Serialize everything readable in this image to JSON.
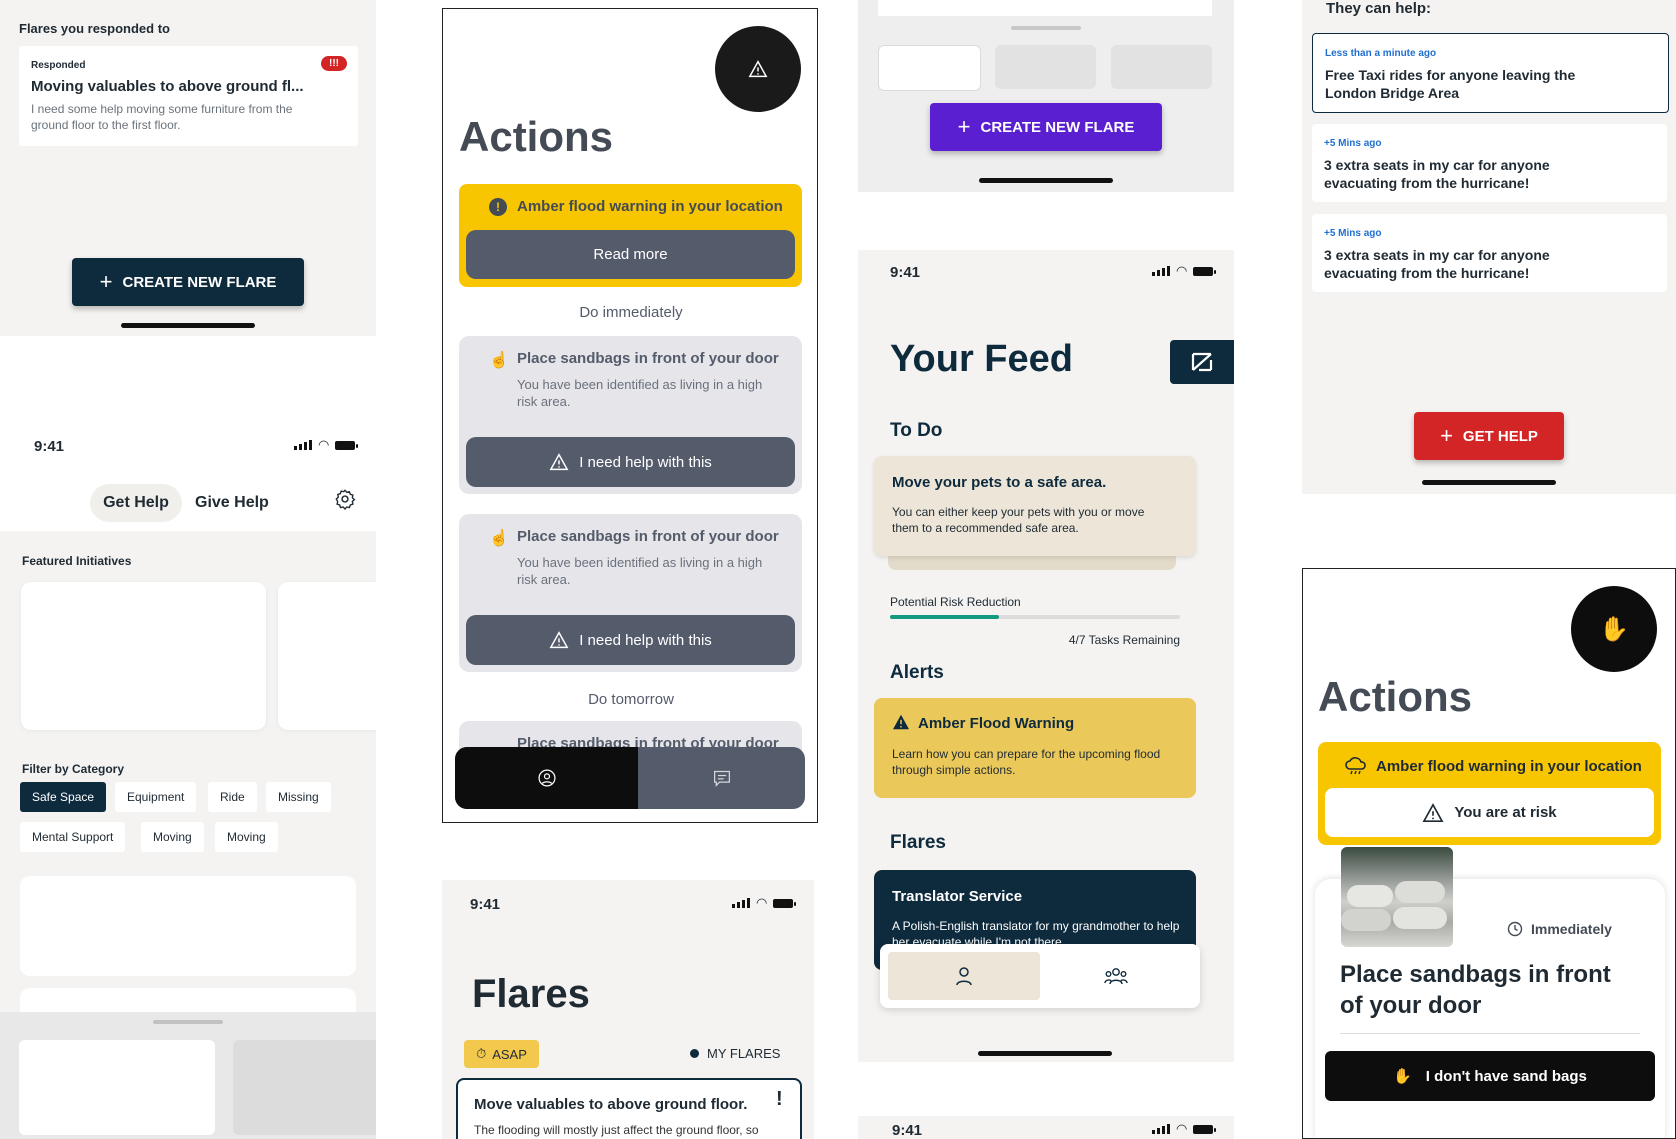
{
  "col1_top": {
    "section_title": "Flares you responded to",
    "card": {
      "badge": "Responded",
      "urgency": "!!!",
      "title": "Moving valuables to above ground fl...",
      "body": "I need some help moving some furniture from the ground floor to the first floor."
    },
    "create_label": "CREATE NEW FLARE"
  },
  "col1_main": {
    "status_time": "9:41",
    "tabs": [
      "Get Help",
      "Give Help"
    ],
    "featured_title": "Featured Initiatives",
    "filter_title": "Filter by Category",
    "chips": [
      "Safe Space",
      "Equipment",
      "Ride",
      "Missing",
      "Mental Support",
      "Moving",
      "Moving"
    ]
  },
  "col2_actions": {
    "title": "Actions",
    "alert_text": "Amber flood warning in your location",
    "read_more": "Read more",
    "group1": "Do immediately",
    "tasks": [
      {
        "title": "Place sandbags in front of your door",
        "desc": "You have been identified as living in a high risk area.",
        "help": "I need help with this"
      },
      {
        "title": "Place sandbags in front of your door",
        "desc": "You have been identified as living in a high risk area.",
        "help": "I need help with this"
      }
    ],
    "group2": "Do tomorrow",
    "peek_task": "Place sandbags in front of your door"
  },
  "col2_flares": {
    "status_time": "9:41",
    "title": "Flares",
    "asap": "ASAP",
    "my_flares": "MY FLARES",
    "card_title": "Move valuables to above ground floor.",
    "card_body": "The flooding will mostly just affect the ground floor, so any valuables should be moved higher up."
  },
  "col3_top": {
    "create_label": "CREATE NEW FLARE"
  },
  "col3_feed": {
    "status_time": "9:41",
    "title": "Your Feed",
    "todo_title": "To Do",
    "todo_card": {
      "title": "Move your pets to a safe area.",
      "body": "You can either keep your pets with you or move them to a recommended safe area."
    },
    "risk_label": "Potential Risk Reduction",
    "risk_progress": 0.375,
    "tasks_remaining": "4/7 Tasks Remaining",
    "alerts_title": "Alerts",
    "alert": {
      "title": "Amber Flood Warning",
      "body": "Learn how you can prepare for the upcoming flood through simple actions."
    },
    "flares_title": "Flares",
    "flare": {
      "title": "Translator Service",
      "body": "A Polish-English translator for my grandmother to help her evacuate while I'm not there."
    }
  },
  "col3_bottom": {
    "status_time": "9:41"
  },
  "col4_top": {
    "section_title": "They can help:",
    "offers": [
      {
        "when": "Less than a minute ago",
        "what": "Free Taxi rides for anyone leaving the London Bridge Area"
      },
      {
        "when": "+5 Mins ago",
        "what": "3 extra seats in my car for anyone evacuating from the hurricane!"
      },
      {
        "when": "+5 Mins ago",
        "what": "3 extra seats in my car for anyone evacuating from the hurricane!"
      }
    ],
    "get_help": "GET HELP"
  },
  "col4_actions": {
    "title": "Actions",
    "alert_text": "Amber flood warning in your location",
    "risk_text": "You are at risk",
    "when": "Immediately",
    "task_title": "Place sandbags in front of your door",
    "no_bags": "I don't have sand bags"
  },
  "colors": {
    "navy": "#0e2a3d",
    "amber": "#f8c600",
    "purple": "#5a1fd1",
    "red": "#d32525",
    "teal": "#159a82",
    "slate": "#545b6b"
  }
}
